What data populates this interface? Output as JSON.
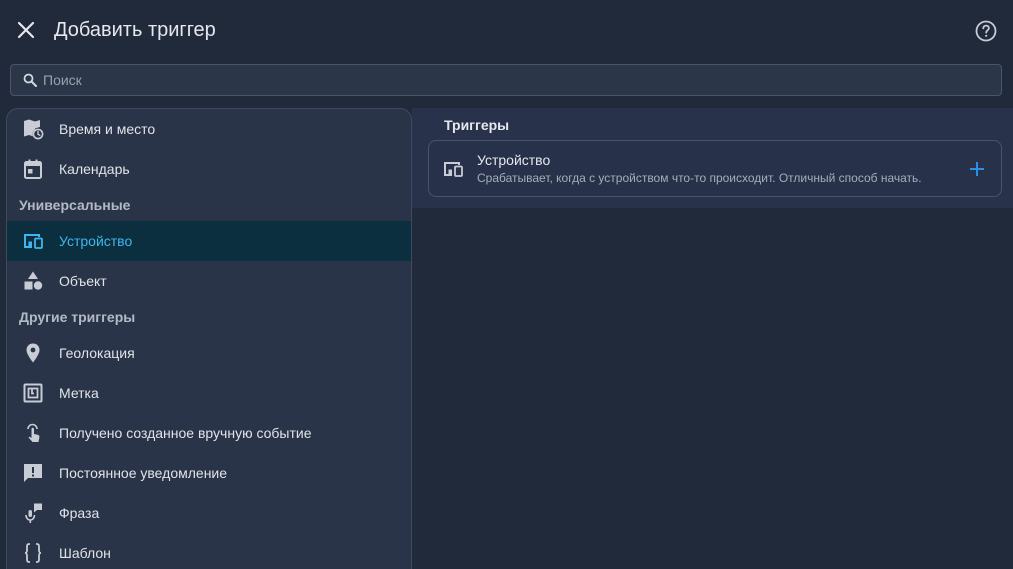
{
  "header": {
    "title": "Добавить триггер",
    "close_icon": "close-icon",
    "help_icon": "help-icon"
  },
  "search": {
    "placeholder": "Поиск",
    "value": ""
  },
  "sidebar": {
    "items_top": [
      {
        "label": "Время и место",
        "icon": "map-clock-icon"
      },
      {
        "label": "Календарь",
        "icon": "calendar-icon"
      }
    ],
    "section_universal": "Универсальные",
    "items_universal": [
      {
        "label": "Устройство",
        "icon": "devices-icon",
        "selected": true
      },
      {
        "label": "Объект",
        "icon": "shapes-icon"
      }
    ],
    "section_other": "Другие триггеры",
    "items_other": [
      {
        "label": "Геолокация",
        "icon": "map-marker-icon"
      },
      {
        "label": "Метка",
        "icon": "nfc-tag-icon"
      },
      {
        "label": "Получено созданное вручную событие",
        "icon": "gesture-tap-icon"
      },
      {
        "label": "Постоянное уведомление",
        "icon": "message-alert-icon"
      },
      {
        "label": "Фраза",
        "icon": "microphone-message-icon"
      },
      {
        "label": "Шаблон",
        "icon": "code-braces-icon"
      }
    ]
  },
  "main": {
    "section_title": "Триггеры",
    "card": {
      "title": "Устройство",
      "description": "Срабатывает, когда с устройством что-то происходит. Отличный способ начать.",
      "icon": "devices-icon",
      "add_icon": "plus-icon"
    }
  },
  "colors": {
    "accent": "#3fb6ef",
    "add": "#2b8fe8",
    "background": "#212a3a",
    "selected_bg": "#0c2f3f"
  }
}
